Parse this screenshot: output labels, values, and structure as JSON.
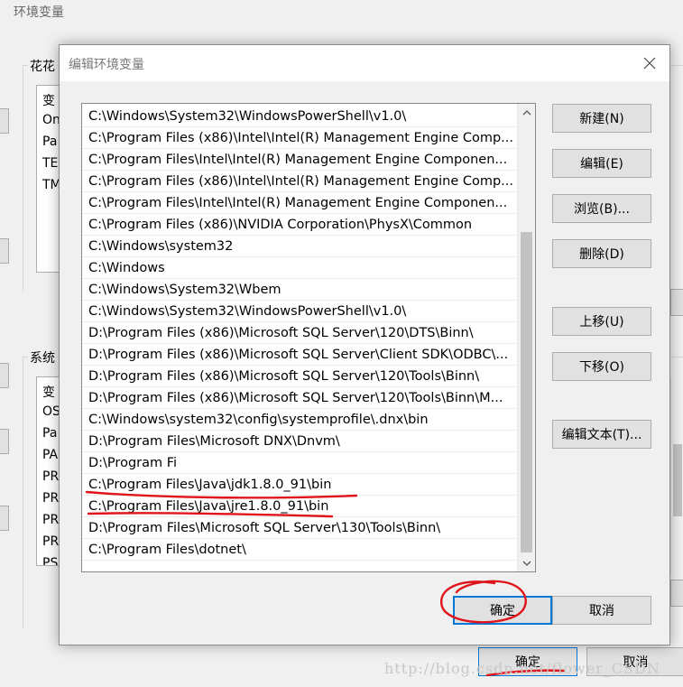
{
  "background_window": {
    "title": "环境变量",
    "user_group_label": "花花",
    "user_list_rows": [
      "变",
      "On",
      "Pa",
      "TE",
      "TM"
    ],
    "system_group_label": "系统",
    "system_list_rows": [
      "变",
      "OS",
      "Pa",
      "PA",
      "PR",
      "PR",
      "PR",
      "PR",
      "PS"
    ],
    "ok_label": "确定",
    "cancel_label": "取消"
  },
  "dialog": {
    "title": "编辑环境变量",
    "close_glyph": "✕",
    "path_entries": [
      "C:\\Windows\\System32\\WindowsPowerShell\\v1.0\\",
      "C:\\Program Files (x86)\\Intel\\Intel(R) Management Engine Comp...",
      "C:\\Program Files\\Intel\\Intel(R) Management Engine Componen...",
      "C:\\Program Files (x86)\\Intel\\Intel(R) Management Engine Comp...",
      "C:\\Program Files\\Intel\\Intel(R) Management Engine Componen...",
      "C:\\Program Files (x86)\\NVIDIA Corporation\\PhysX\\Common",
      "C:\\Windows\\system32",
      "C:\\Windows",
      "C:\\Windows\\System32\\Wbem",
      "C:\\Windows\\System32\\WindowsPowerShell\\v1.0\\",
      "D:\\Program Files (x86)\\Microsoft SQL Server\\120\\DTS\\Binn\\",
      "D:\\Program Files (x86)\\Microsoft SQL Server\\Client SDK\\ODBC\\...",
      "D:\\Program Files (x86)\\Microsoft SQL Server\\120\\Tools\\Binn\\",
      "D:\\Program Files (x86)\\Microsoft SQL Server\\120\\Tools\\Binn\\M...",
      "C:\\Windows\\system32\\config\\systemprofile\\.dnx\\bin",
      "D:\\Program Files\\Microsoft DNX\\Dnvm\\",
      "D:\\Program Fi",
      "C:\\Program Files\\Java\\jdk1.8.0_91\\bin",
      "C:\\Program Files\\Java\\jre1.8.0_91\\bin",
      "D:\\Program Files\\Microsoft SQL Server\\130\\Tools\\Binn\\",
      "C:\\Program Files\\dotnet\\"
    ],
    "buttons": {
      "new": "新建(N)",
      "edit": "编辑(E)",
      "browse": "浏览(B)...",
      "delete": "删除(D)",
      "move_up": "上移(U)",
      "move_down": "下移(O)",
      "edit_text": "编辑文本(T)..."
    },
    "ok_label": "确定",
    "cancel_label": "取消"
  },
  "annotation_color": "#e0151b",
  "watermark": "http://blog.csdn.net/flower_CSDN"
}
